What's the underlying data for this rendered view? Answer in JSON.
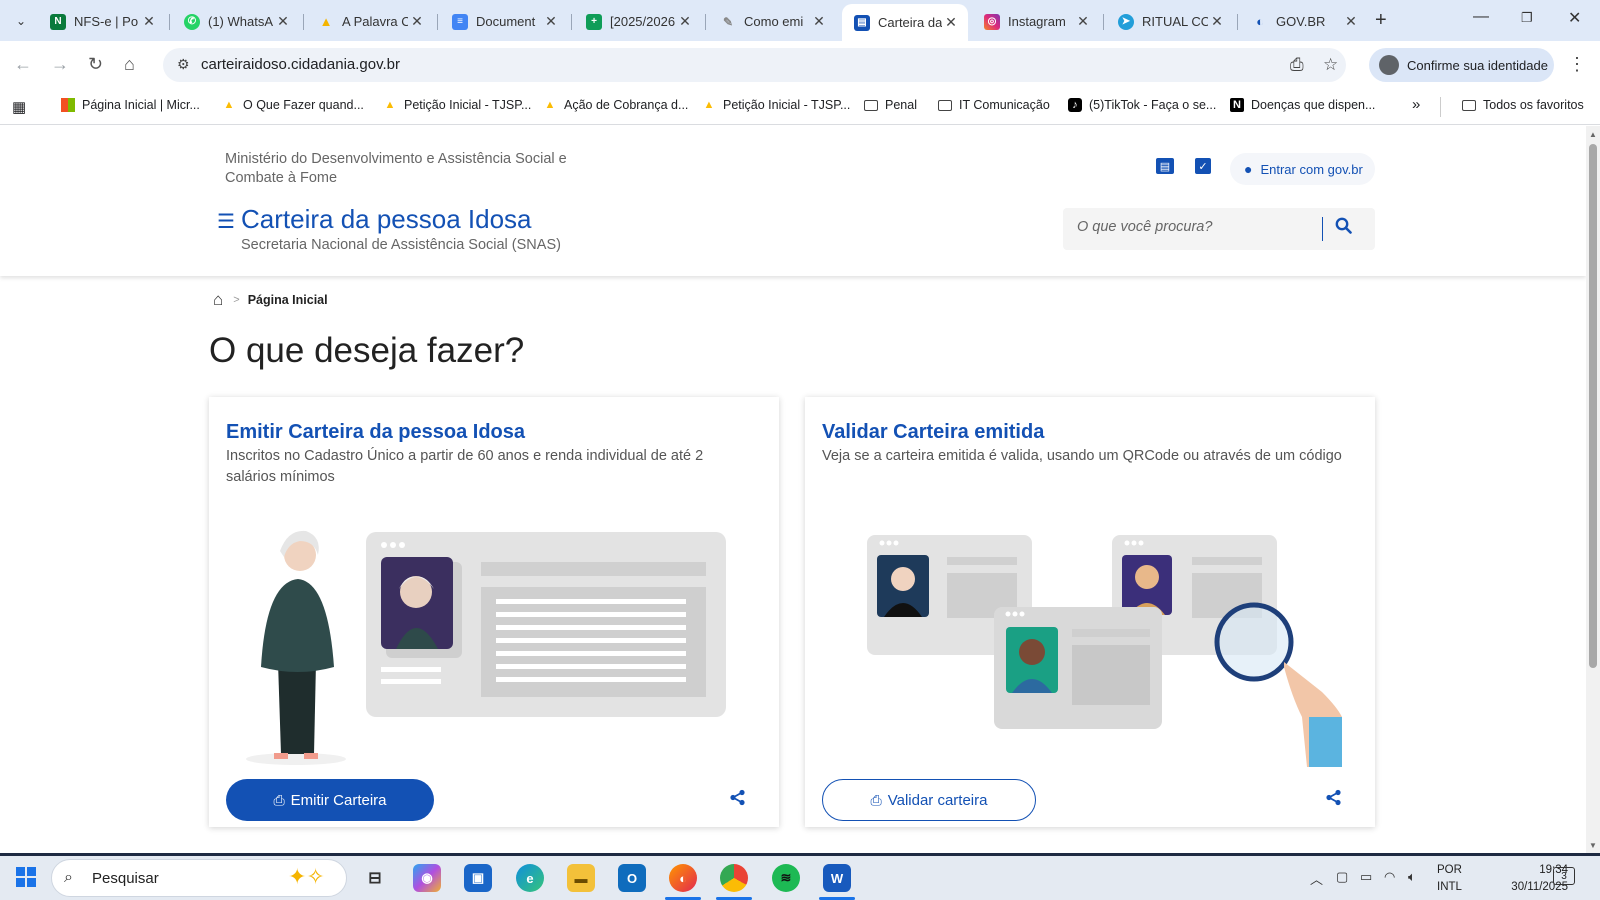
{
  "browser": {
    "tabs": [
      {
        "title": "NFS-e | Po",
        "favicon": "nfse-icon",
        "color": "#0a7a3c",
        "glyph": "N"
      },
      {
        "title": "(1) WhatsA",
        "favicon": "whatsapp-icon",
        "color": "#25d366",
        "glyph": "✆"
      },
      {
        "title": "A Palavra C",
        "favicon": "google-drive-icon",
        "color": "#f4b400",
        "glyph": "▲"
      },
      {
        "title": "Document",
        "favicon": "google-docs-icon",
        "color": "#4285f4",
        "glyph": "≡"
      },
      {
        "title": "[2025/2026",
        "favicon": "google-sheets-icon",
        "color": "#0f9d58",
        "glyph": "+"
      },
      {
        "title": "Como emi",
        "favicon": "pdf-tool-icon",
        "color": "#9e9e9e",
        "glyph": "P"
      },
      {
        "title": "Carteira da",
        "favicon": "gov-card-icon",
        "color": "#1351b4",
        "glyph": "▤"
      },
      {
        "title": "Instagram",
        "favicon": "instagram-icon",
        "color": "#d6249f",
        "glyph": "◎"
      },
      {
        "title": "RITUAL CO",
        "favicon": "telegram-icon",
        "color": "#229ed9",
        "glyph": "➤"
      },
      {
        "title": "GOV.BR",
        "favicon": "govbr-icon",
        "color": "#1351b4",
        "glyph": "G"
      }
    ],
    "new_tab": "+",
    "url": "carteiraidoso.cidadania.gov.br",
    "identity_label": "Confirme sua identidade",
    "bookmarks": [
      {
        "label": "Página Inicial | Micr...",
        "icon": "microsoft-icon"
      },
      {
        "label": "O Que Fazer quand...",
        "icon": "google-ads-icon"
      },
      {
        "label": "Petição Inicial - TJSP...",
        "icon": "google-ads-icon"
      },
      {
        "label": "Ação de Cobrança d...",
        "icon": "google-ads-icon"
      },
      {
        "label": "Petição Inicial - TJSP...",
        "icon": "google-ads-icon"
      },
      {
        "label": "Penal",
        "icon": "folder-icon"
      },
      {
        "label": "IT Comunicação",
        "icon": "folder-icon"
      },
      {
        "label": "(5)TikTok - Faça o se...",
        "icon": "tiktok-icon"
      },
      {
        "label": "Doenças que dispen...",
        "icon": "notion-icon"
      }
    ],
    "bookmarks_more": "»",
    "all_bookmarks": "Todos os favoritos"
  },
  "site": {
    "ministry": "Ministério do Desenvolvimento e Assistência Social e Combate à Fome",
    "login_label": "Entrar com gov.br",
    "title": "Carteira da pessoa Idosa",
    "subtitle": "Secretaria Nacional de Assistência Social (SNAS)",
    "search_placeholder": "O que você procura?",
    "breadcrumb_current": "Página Inicial",
    "heading": "O que deseja fazer?",
    "cards": [
      {
        "title": "Emitir Carteira da pessoa Idosa",
        "description": "Inscritos no Cadastro Único a partir de 60 anos e renda individual de até 2 salários mínimos",
        "button": "Emitir Carteira"
      },
      {
        "title": "Validar Carteira emitida",
        "description": "Veja se a carteira emitida é valida, usando um QRCode ou através de um código",
        "button": "Validar carteira"
      }
    ],
    "brand_color": "#1351b4"
  },
  "taskbar": {
    "search_label": "Pesquisar",
    "language": "POR",
    "keyboard": "INTL",
    "time": "19:34",
    "date": "30/11/2025",
    "notifications": "3"
  }
}
